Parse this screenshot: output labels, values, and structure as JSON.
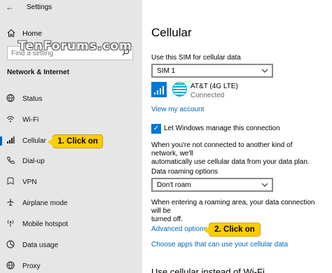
{
  "window": {
    "title": "Settings",
    "back_icon": "←",
    "controls": {
      "minimize": "—",
      "maximize": "☐",
      "close": "✕"
    }
  },
  "sidebar": {
    "home_label": "Home",
    "search_placeholder": "Find a setting",
    "section_title": "Network & Internet",
    "items": [
      {
        "label": "Status",
        "icon": "globe-icon"
      },
      {
        "label": "Wi-Fi",
        "icon": "wifi-icon"
      },
      {
        "label": "Cellular",
        "icon": "cellular-signal-icon",
        "selected": true
      },
      {
        "label": "Dial-up",
        "icon": "phone-icon"
      },
      {
        "label": "VPN",
        "icon": "vpn-icon"
      },
      {
        "label": "Airplane mode",
        "icon": "airplane-icon"
      },
      {
        "label": "Mobile hotspot",
        "icon": "hotspot-icon"
      },
      {
        "label": "Data usage",
        "icon": "data-usage-icon"
      },
      {
        "label": "Proxy",
        "icon": "globe-icon"
      }
    ]
  },
  "watermark": "TenForums.com",
  "callouts": {
    "one": "1. Click on",
    "two": "2. Click on"
  },
  "main": {
    "title": "Cellular",
    "sim_label": "Use this SIM for cellular data",
    "sim_value": "SIM 1",
    "carrier_name": "AT&T (4G LTE)",
    "carrier_status": "Connected",
    "view_account_link": "View my account",
    "manage_checkbox_label": "Let Windows manage this connection",
    "manage_checked": true,
    "manage_desc_1": "When you're not connected to another kind of network, we'll",
    "manage_desc_2": "automatically use cellular data from your data plan.",
    "roaming_label": "Data roaming options",
    "roaming_value": "Don't roam",
    "roaming_desc_1": "When entering a roaming area, your data connection will be",
    "roaming_desc_2": "turned off.",
    "advanced_link": "Advanced options",
    "choose_apps_link": "Choose apps that can use your cellular data",
    "cutoff_text": "Use cellular instead of Wi-Fi"
  },
  "colors": {
    "accent": "#0078d7",
    "link": "#0067b8",
    "callout": "#ffcc00",
    "sidebar_bg": "#e6e6e6"
  }
}
